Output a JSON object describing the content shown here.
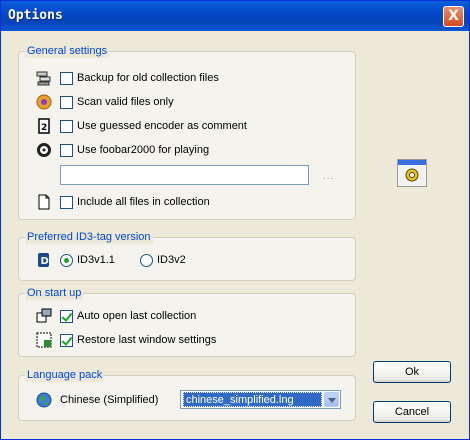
{
  "window": {
    "title": "Options",
    "close_label": "X"
  },
  "general": {
    "legend": "General settings",
    "backup": {
      "label": "Backup for old collection files",
      "checked": false
    },
    "scan_valid": {
      "label": "Scan valid files only",
      "checked": false
    },
    "guessed_encoder": {
      "label": "Use guessed encoder as comment",
      "checked": false
    },
    "use_foobar": {
      "label": "Use foobar2000 for playing",
      "checked": false
    },
    "foobar_path": {
      "value": "",
      "browse_label": "..."
    },
    "include_all": {
      "label": "Include all files in collection",
      "checked": false
    }
  },
  "id3": {
    "legend": "Preferred ID3-tag version",
    "options": [
      {
        "label": "ID3v1.1",
        "selected": true
      },
      {
        "label": "ID3v2",
        "selected": false
      }
    ]
  },
  "startup": {
    "legend": "On start up",
    "auto_open": {
      "label": "Auto open last collection",
      "checked": true
    },
    "restore_window": {
      "label": "Restore last window settings",
      "checked": true
    }
  },
  "language": {
    "legend": "Language pack",
    "name": "Chinese (Simplified)",
    "selected_file": "chinese_simplified.lng"
  },
  "buttons": {
    "ok": "Ok",
    "cancel": "Cancel"
  }
}
